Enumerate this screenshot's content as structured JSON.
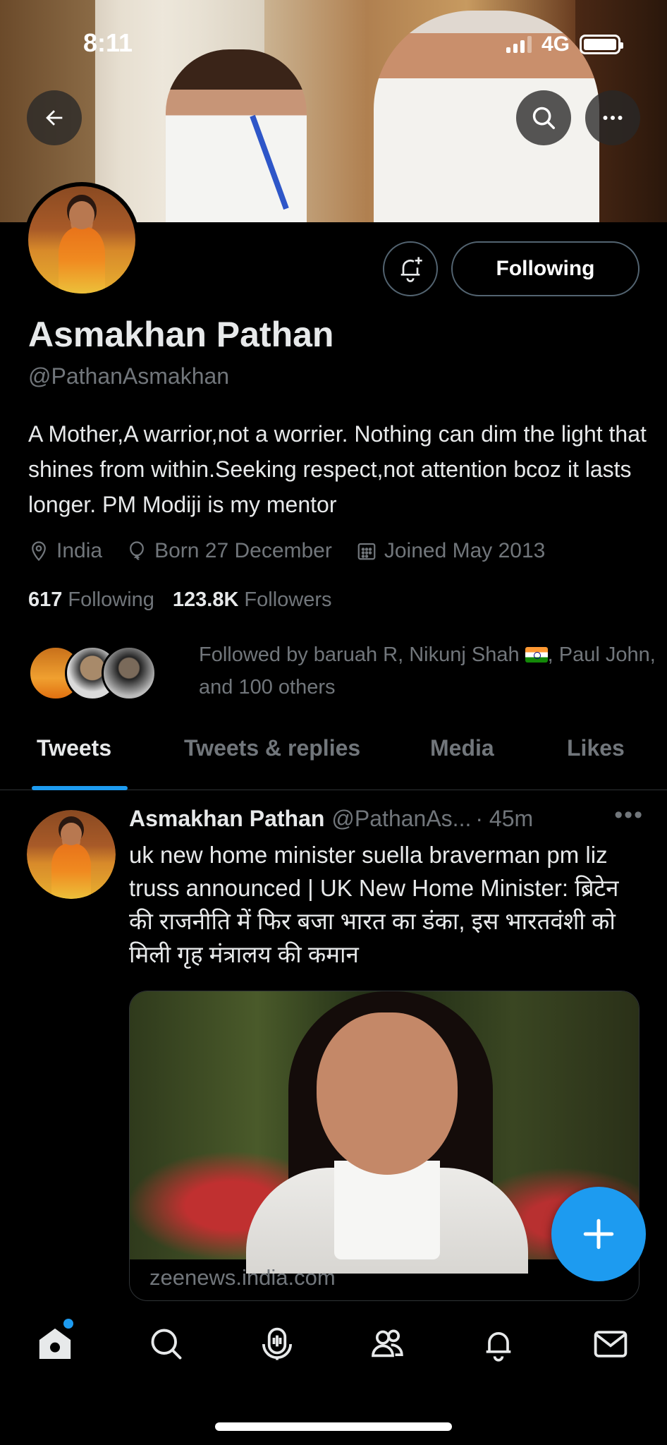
{
  "status_bar": {
    "time": "8:11",
    "network": "4G"
  },
  "profile": {
    "name": "Asmakhan Pathan",
    "handle": "@PathanAsmakhan",
    "bio": "A Mother,A warrior,not a worrier. Nothing can dim the light that shines from within.Seeking respect,not attention bcoz it lasts longer. PM Modiji is my mentor",
    "location": "India",
    "birthday": "Born 27 December",
    "joined": "Joined May 2013",
    "following_count": "617",
    "following_label": "Following",
    "followers_count": "123.8K",
    "followers_label": "Followers",
    "following_button": "Following",
    "followed_by_prefix": "Followed by baruah R, Nikunj Shah",
    "followed_by_suffix": ", Paul John, and 100 others"
  },
  "tabs": [
    {
      "label": "Tweets",
      "active": true
    },
    {
      "label": "Tweets & replies",
      "active": false
    },
    {
      "label": "Media",
      "active": false
    },
    {
      "label": "Likes",
      "active": false
    }
  ],
  "tweet": {
    "author_name": "Asmakhan Pathan",
    "author_handle": "@PathanAs...",
    "time": "· 45m",
    "text": "uk new home minister suella braverman pm liz truss announced | UK New Home Minister: ब्रिटेन की राजनीति में फिर बजा भारत का डंका, इस भारतवंशी को मिली गृह मंत्रालय की कमान",
    "card_domain": "zeenews.india.com"
  },
  "colors": {
    "accent": "#1d9bf0",
    "background": "#000000",
    "secondary_text": "#71767b"
  },
  "icons": [
    "back-arrow-icon",
    "search-icon",
    "more-icon",
    "bell-plus-icon",
    "location-icon",
    "balloon-icon",
    "calendar-icon",
    "compose-plus-icon",
    "home-icon",
    "search-icon",
    "spaces-icon",
    "communities-icon",
    "notifications-icon",
    "messages-icon"
  ]
}
